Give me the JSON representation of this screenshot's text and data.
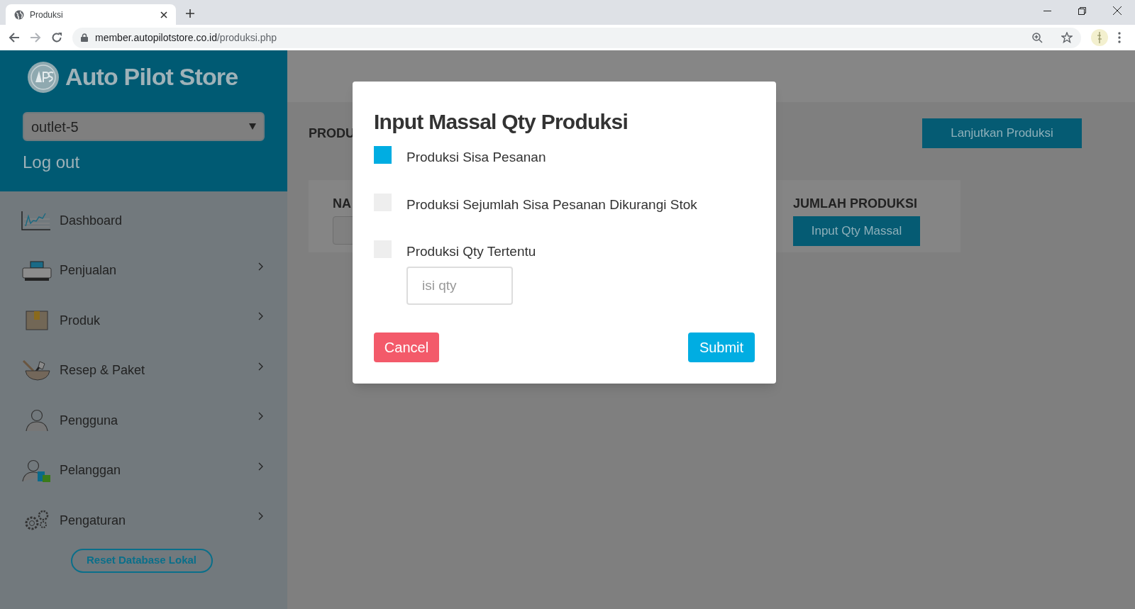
{
  "browser": {
    "tab_title": "Produksi",
    "url_host": "member.autopilotstore.co.id",
    "url_path": "/produksi.php"
  },
  "sidebar": {
    "brand": "Auto Pilot Store",
    "outlet": "outlet-5",
    "logout": "Log out",
    "items": [
      {
        "label": "Dashboard",
        "expandable": false
      },
      {
        "label": "Penjualan",
        "expandable": true
      },
      {
        "label": "Produk",
        "expandable": true
      },
      {
        "label": "Resep & Paket",
        "expandable": true
      },
      {
        "label": "Pengguna",
        "expandable": true
      },
      {
        "label": "Pelanggan",
        "expandable": true
      },
      {
        "label": "Pengaturan",
        "expandable": true
      }
    ],
    "reset_button": "Reset Database Lokal"
  },
  "page": {
    "heading": "PRODU",
    "continue_button": "Lanjutkan Produksi",
    "column_1": "NA",
    "column_2": "JUMLAH PRODUKSI",
    "mass_button": "Input Qty Massal"
  },
  "modal": {
    "title": "Input Massal Qty Produksi",
    "options": [
      {
        "label": "Produksi Sisa Pesanan",
        "checked": true
      },
      {
        "label": "Produksi Sejumlah Sisa Pesanan Dikurangi Stok",
        "checked": false
      },
      {
        "label": "Produksi Qty Tertentu",
        "checked": false
      }
    ],
    "qty_placeholder": "isi qty",
    "cancel": "Cancel",
    "submit": "Submit"
  }
}
